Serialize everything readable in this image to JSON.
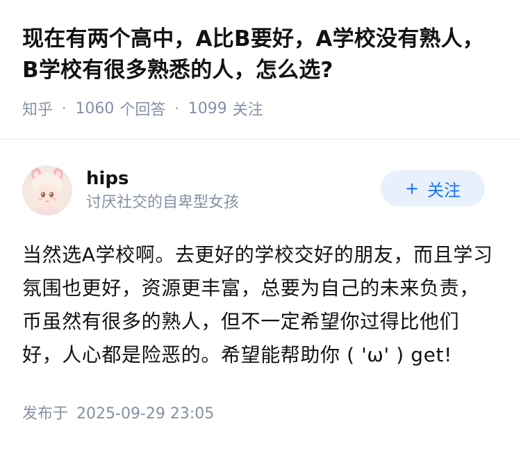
{
  "question": {
    "title": "现在有两个高中，A比B要好，A学校没有熟人，B学校有很多熟悉的人，怎么选?",
    "source": "知乎",
    "answer_count": "1060",
    "answer_label": "个回答",
    "follower_count": "1099",
    "follower_label": "关注"
  },
  "answer": {
    "author": {
      "name": "hips",
      "bio": "讨厌社交的自卑型女孩",
      "avatar_icon": "anime-girl-avatar"
    },
    "follow_button": {
      "plus": "+",
      "label": "关注"
    },
    "content": "当然选A学校啊。去更好的学校交好的朋友，而且学习氛围也更好，资源更丰富，总要为自己的未来负责，币虽然有很多的熟人，但不一定希望你过得比他们好，人心都是险恶的。希望能帮助你 ( 'ω' ) get!",
    "published_label": "发布于",
    "published_time": "2025-09-29 23:05"
  },
  "colors": {
    "meta_gray": "#8590a6",
    "brand_blue": "#1772f6",
    "follow_bg": "#e8f0fb",
    "text": "#121212"
  }
}
